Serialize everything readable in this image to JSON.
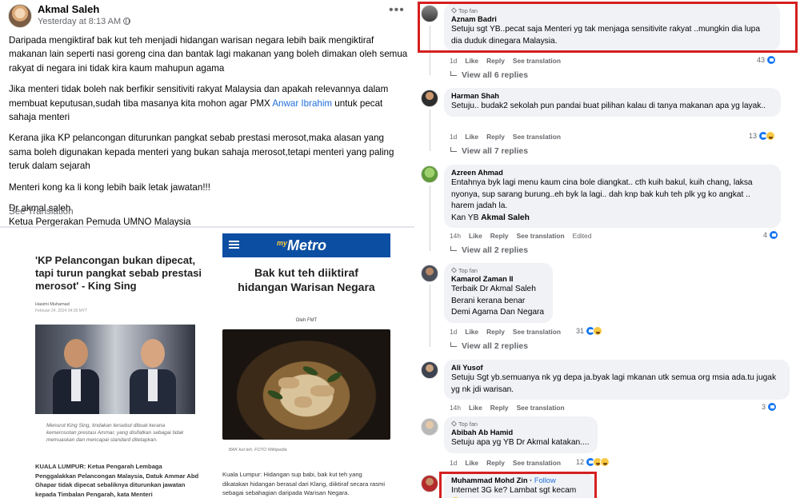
{
  "post": {
    "author": "Akmal Saleh",
    "timestamp": "Yesterday at 8:13 AM",
    "more_label": "•••",
    "paragraph_1": "Daripada mengiktiraf bak kut teh menjadi hidangan warisan negara lebih baik mengiktiraf makanan lain seperti nasi goreng cina dan bantak lagi makanan yang boleh dimakan oleh semua rakyat di negara ini tidak kira kaum mahupun agama",
    "paragraph_2_before": "Jika menteri tidak boleh nak berfikir sensitiviti rakyat Malaysia dan apakah relevannya dalam membuat keputusan,sudah tiba masanya kita mohon agar PMX ",
    "paragraph_2_mention": "Anwar Ibrahim",
    "paragraph_2_after": " untuk pecat sahaja menteri",
    "paragraph_3": "Kerana jika KP pelancongan diturunkan pangkat sebab prestasi merosot,maka alasan yang sama boleh digunakan kepada menteri yang bukan sahaja merosot,tetapi menteri yang paling teruk dalam sejarah",
    "paragraph_4": "Menteri kong ka li kong lebih baik letak jawatan!!!",
    "signature_1": "Dr akmal saleh",
    "signature_2": "Ketua Pergerakan Pemuda UMNO Malaysia",
    "see_translation": "See Translation",
    "article_1": {
      "headline": "'KP Pelancongan bukan dipecat, tapi turun pangkat sebab prestasi merosot' - King Sing",
      "author": "Hasimi Muhamad",
      "date": "Februari 24, 2024 04:35 MYT",
      "caption": "Menurut King Sing, tindakan tersebut dibuat kerana kemerosotan prestasi Ammar, yang disifatkan sebagai tidak memuaskan dan mencapai standard ditetapkan.",
      "lead": "KUALA LUMPUR: Ketua Pengarah Lembaga Penggalakkan Pelancongan Malaysia, Datuk Ammar Abd Ghapar tidak dipecat sebaliknya diturunkan jawatan kepada Timbalan Pengarah, kata Menteri"
    },
    "article_2": {
      "logo_prefix": "my",
      "logo": "Metro",
      "headline": "Bak kut teh diiktiraf hidangan Warisan Negara",
      "byline": "Oleh FMT",
      "caption": "BAK kut teh. FOTO Wikipedia",
      "lead": "Kuala Lumpur: Hidangan sup babi, bak kut teh yang dikatakan hidangan berasal dari Klang, diiktiraf secara rasmi sebagai sebahagian daripada Warisan Negara."
    }
  },
  "comments": [
    {
      "badge": "Top fan",
      "name": "Aznam Badri",
      "text": "Setuju sgt YB..pecat saja Menteri yg tak menjaga sensitivite rakyat ..mungkin dia lupa dia duduk dinegara Malaysia.",
      "time": "1d",
      "like": "Like",
      "reply": "Reply",
      "translation": "See translation",
      "reaction_count": "43",
      "view_replies": "View all 6 replies"
    },
    {
      "name": "Harman Shah",
      "text": "Setuju.. budak2 sekolah pun pandai buat pilihan kalau di tanya makanan apa yg layak..",
      "time": "1d",
      "like": "Like",
      "reply": "Reply",
      "translation": "See translation",
      "reaction_count": "13",
      "view_replies": "View all 7 replies"
    },
    {
      "name": "Azreen Ahmad",
      "text": "Entahnya byk lagi menu kaum cina bole diangkat.. cth kuih bakul, kuih chang, laksa nyonya, sup sarang burung..eh byk la lagi.. dah knp bak kuh teh plk yg ko angkat .. harem jadah la.",
      "text_line_2_prefix": "Kan YB ",
      "text_line_2_bold": "Akmal Saleh",
      "time": "14h",
      "like": "Like",
      "reply": "Reply",
      "translation": "See translation",
      "edited": "Edited",
      "reaction_count": "4",
      "view_replies": "View all 2 replies"
    },
    {
      "badge": "Top fan",
      "name": "Kamarol Zaman II",
      "line_1": "Terbaik Dr Akmal Saleh",
      "line_2": "Berani kerana benar",
      "line_3": "Demi Agama Dan Negara",
      "time": "1d",
      "like": "Like",
      "reply": "Reply",
      "translation": "See translation",
      "reaction_count": "31",
      "view_replies": "View all 2 replies"
    },
    {
      "name": "Ali Yusof",
      "text": "Setuju Sgt yb.semuanya nk yg depa ja.byak lagi mkanan utk semua org msia ada.tu jugak yg nk jdi warisan.",
      "time": "14h",
      "like": "Like",
      "reply": "Reply",
      "translation": "See translation",
      "reaction_count": "3"
    },
    {
      "badge": "Top fan",
      "name": "Abibah Ab Hamid",
      "text": "Setuju apa yg YB Dr Akmal katakan....",
      "time": "1d",
      "like": "Like",
      "reply": "Reply",
      "translation": "See translation",
      "reaction_count": "12"
    },
    {
      "name": "Muhammad Mohd Zin",
      "follow": "Follow",
      "separator": " · ",
      "text": "Internet 3G ke? Lambat sgt kecam"
    }
  ],
  "colors": {
    "accent": "#216fdb",
    "highlight": "#d51f1f",
    "bubble": "#f0f2f5",
    "meta": "#65676b"
  }
}
